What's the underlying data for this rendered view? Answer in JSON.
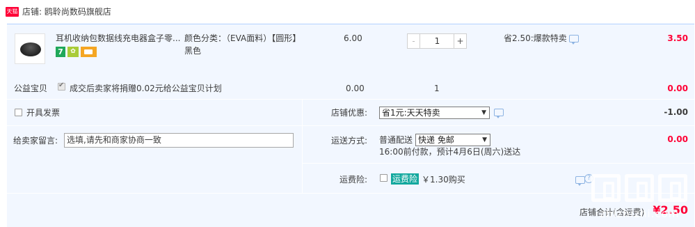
{
  "shop": {
    "badge_text": "天猫",
    "label": "店铺: 鸥聆尚数码旗舰店"
  },
  "item": {
    "title": "耳机收纳包数据线充电器盒子零...",
    "service_icons": [
      "seven-day-return-icon",
      "insurance-shield-icon",
      "credit-card-installment-icon"
    ],
    "seven_label": "7",
    "sku_label": "颜色分类：（EVA面料）【圆形】",
    "sku_value": "黑色",
    "unit_price": "6.00",
    "qty_minus": "-",
    "qty_value": "1",
    "qty_plus": "+",
    "promo": "省2.50:爆款特卖",
    "total": "3.50"
  },
  "charity": {
    "label": "公益宝贝",
    "checked": true,
    "text": "成交后卖家将捐赠0.02元给公益宝贝计划",
    "price": "0.00",
    "qty": "1",
    "total": "0.00"
  },
  "invoice": {
    "label": "开具发票",
    "checked": false
  },
  "discount": {
    "label": "店铺优惠:",
    "selected": "省1元:天天特卖",
    "amount": "-1.00"
  },
  "message": {
    "label": "给卖家留言:",
    "placeholder": "选填,请先和商家协商一致"
  },
  "shipping": {
    "label": "运送方式:",
    "method": "普通配送",
    "selected": "快递 免邮",
    "note": "16:00前付款，预计4月6日(周六)送达",
    "amount": "0.00"
  },
  "insurance": {
    "label": "运费险:",
    "checked": false,
    "badge": "运费险",
    "price": "￥1.30购买",
    "amount": ""
  },
  "summary": {
    "label": "店铺合计(含运费)",
    "value": "¥2.50"
  },
  "watermark": {
    "text": "zhizhizhi.com"
  },
  "colors": {
    "price_red": "#ff0036",
    "panel_bg": "#f2f7ff",
    "panel_border": "#b2d1ff",
    "insurance_teal": "#13a89e"
  }
}
